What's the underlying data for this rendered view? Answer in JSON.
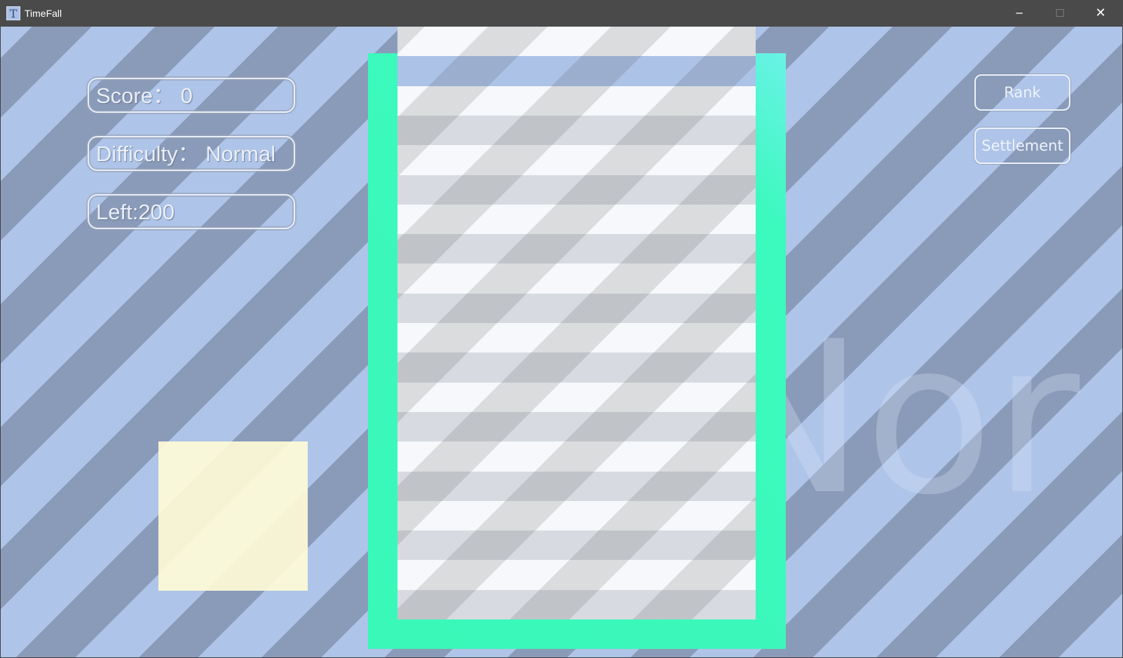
{
  "window": {
    "title": "TimeFall",
    "icon_letter": "T",
    "controls": {
      "minimize": "─",
      "maximize": "☐",
      "close": "✕"
    }
  },
  "hud": {
    "score": "Score： 0",
    "difficulty": "Difficulty： Normal",
    "left": "Left:200"
  },
  "buttons": {
    "rank": "Rank",
    "settlement": "Settlement"
  },
  "background_word": "Nor",
  "colors": {
    "bg_stripe_light": "#aec4e8",
    "bg_stripe_dark": "#8a9bb9",
    "well_frame": "#3af8b8",
    "active_row": "#acc2e7",
    "next_piece": "#fffbd7"
  },
  "well": {
    "active_row_index": 1
  }
}
